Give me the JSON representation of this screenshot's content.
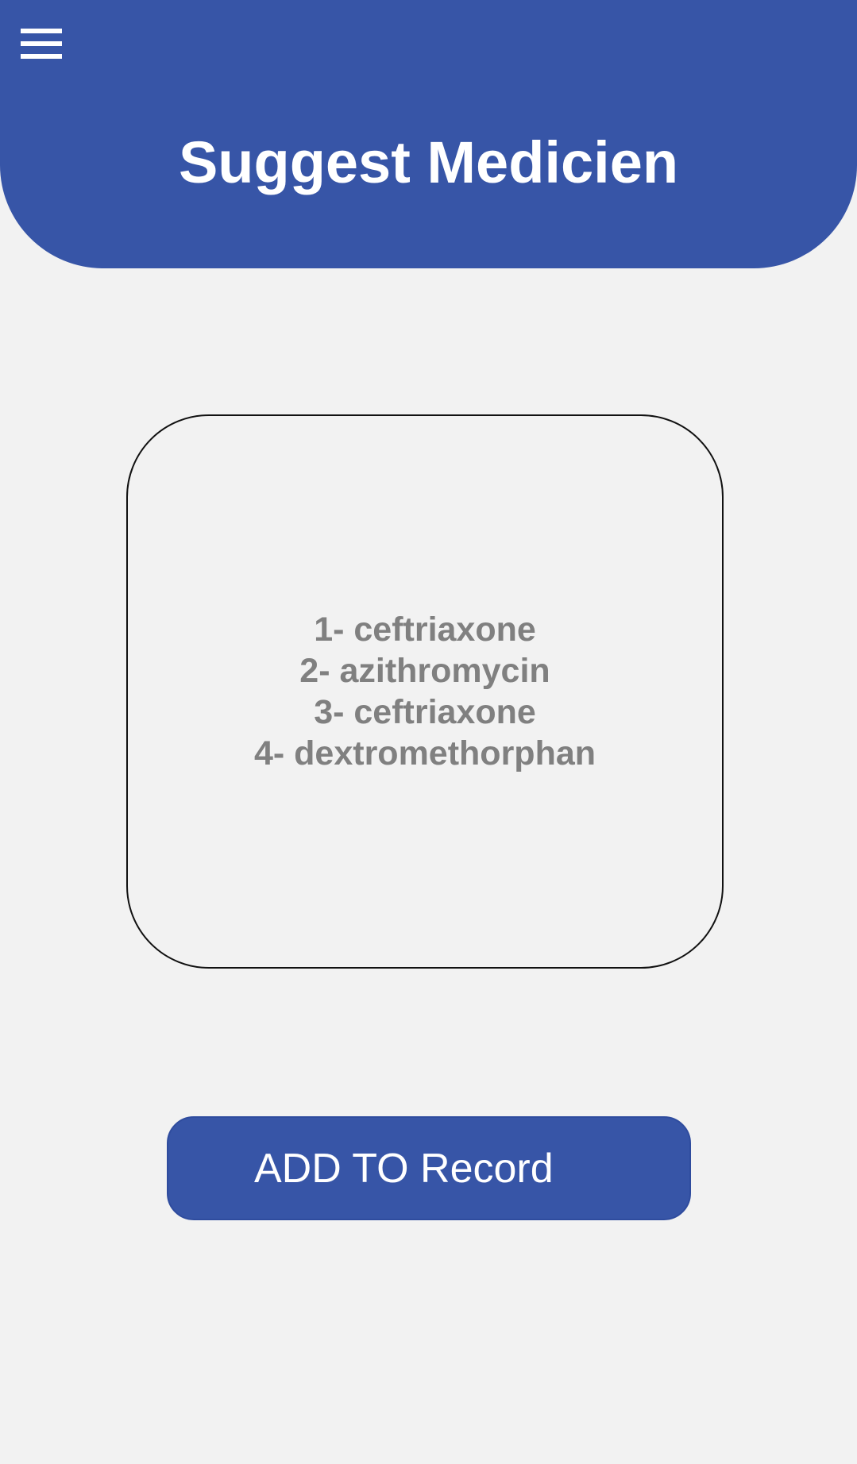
{
  "header": {
    "menu_icon": "hamburger-menu-icon",
    "title": "Suggest Medicien",
    "background_color": "#3755a7"
  },
  "medicines": [
    "1- ceftriaxone",
    "2- azithromycin",
    "3- ceftriaxone",
    "4- dextromethorphan"
  ],
  "actions": {
    "add_label": "ADD TO Record"
  }
}
